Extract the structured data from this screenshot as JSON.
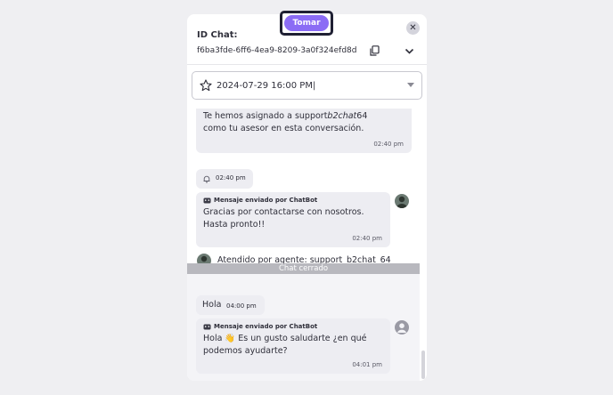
{
  "header": {
    "take_label": "Tomar",
    "id_label": "ID Chat:",
    "chat_id": "f6ba3fde-6ff6-4ea9-8209-3a0f324efd8d",
    "close_glyph": "✕",
    "icons": [
      "copy-icon",
      "chevron-down-icon",
      "close-icon"
    ]
  },
  "date_field": {
    "value": "2024-07-29 16:00 PM|",
    "icon": "star-icon"
  },
  "messages": [
    {
      "text_part1": "Te hemos asignado a support",
      "text_italic": "b2chat",
      "text_part2": "64",
      "line2": "como tu asesor en esta conversación.",
      "time": "02:40 pm"
    },
    {
      "icon": "bell-icon",
      "time": "02:40 pm"
    },
    {
      "header": "Mensaje enviado por ChatBot",
      "line1": "Gracias por contactarse con nosotros.",
      "line2": "Hasta pronto!!",
      "time": "02:40 pm"
    }
  ],
  "agent_notice": "Atendido por agente: support_b2chat_64",
  "closed_label": "Chat cerrado",
  "lower_messages": [
    {
      "text": "Hola",
      "time": "04:00 pm"
    },
    {
      "header": "Mensaje enviado por ChatBot",
      "line1": "Hola 👋 Es un gusto saludarte ¿en qué",
      "line2": "podemos ayudarte?",
      "time": "04:01 pm"
    }
  ],
  "colors": {
    "accent": "#8b6cf5",
    "bubble": "#ededf2",
    "closed_bar": "#b8b8be"
  }
}
